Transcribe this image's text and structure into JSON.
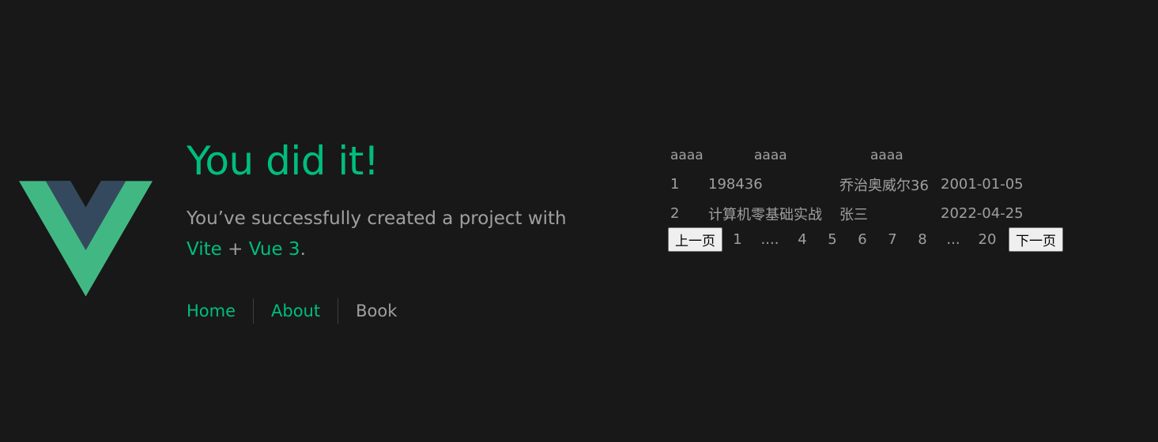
{
  "hero": {
    "title": "You did it!",
    "subtitle_prefix": "You’ve successfully created a project with",
    "link_vite": "Vite",
    "plus": "+",
    "link_vue": "Vue 3",
    "period": "."
  },
  "nav": {
    "home": "Home",
    "about": "About",
    "book": "Book"
  },
  "table": {
    "headers": [
      "aaaa",
      "aaaa",
      "aaaa"
    ],
    "rows": [
      [
        "1",
        "198436",
        "乔治奥威尔36",
        "2001-01-05"
      ],
      [
        "2",
        "计算机零基础实战",
        "张三",
        "2022-04-25"
      ]
    ]
  },
  "pager": {
    "prev": "上一页",
    "next": "下一页",
    "items": [
      "1",
      "....",
      "4",
      "5",
      "6",
      "7",
      "8",
      "...",
      "20"
    ]
  },
  "colors": {
    "accent": "#00bd7e",
    "background": "#181818",
    "logo_dark": "#35495e",
    "logo_light": "#41b883"
  }
}
